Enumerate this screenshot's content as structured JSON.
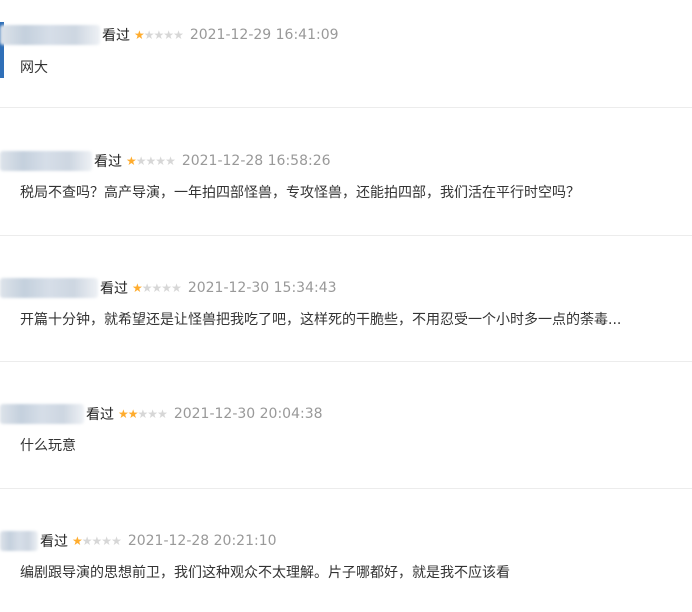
{
  "reviews": [
    {
      "watched": "看过",
      "stars": 1,
      "time": "2021-12-29 16:41:09",
      "content": "网大"
    },
    {
      "watched": "看过",
      "stars": 1,
      "time": "2021-12-28 16:58:26",
      "content": "税局不查吗？高产导演，一年拍四部怪兽，专攻怪兽，还能拍四部，我们活在平行时空吗？"
    },
    {
      "watched": "看过",
      "stars": 1,
      "time": "2021-12-30 15:34:43",
      "content": "开篇十分钟，就希望还是让怪兽把我吃了吧，这样死的干脆些，不用忍受一个小时多一点的荼毒..."
    },
    {
      "watched": "看过",
      "stars": 2,
      "time": "2021-12-30 20:04:38",
      "content": "什么玩意"
    },
    {
      "watched": "看过",
      "stars": 1,
      "time": "2021-12-28 20:21:10",
      "content": "编剧跟导演的思想前卫，我们这种观众不太理解。片子哪都好，就是我不应该看"
    }
  ],
  "colors": {
    "star_on": "#ffac2d",
    "star_off": "#d7d7d7",
    "time": "#999999",
    "divider": "#ececec"
  },
  "icons": {
    "rating_star": "star-icon"
  }
}
